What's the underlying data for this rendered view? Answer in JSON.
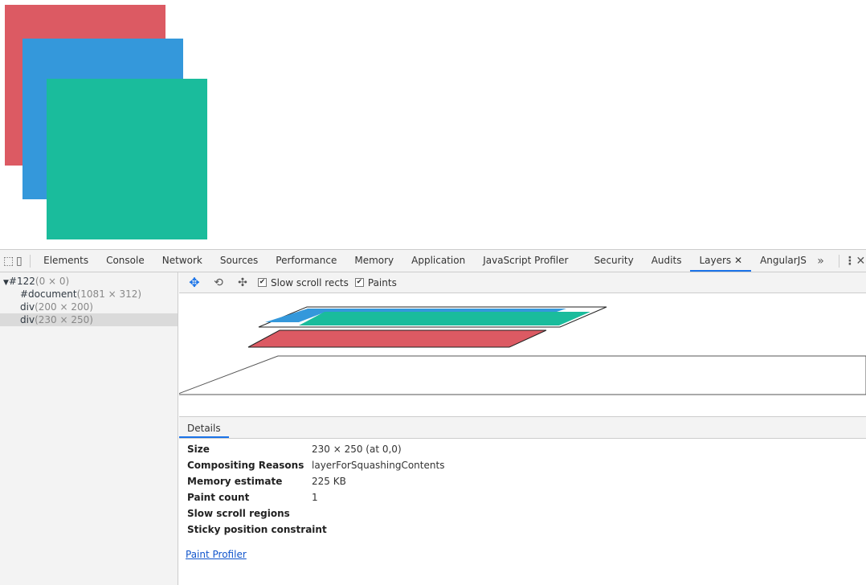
{
  "page": {
    "colors": {
      "red": "#dc5a63",
      "blue": "#3498db",
      "green": "#1abc9c"
    }
  },
  "tabs": [
    "Elements",
    "Console",
    "Network",
    "Sources",
    "Performance",
    "Memory",
    "Application",
    "JavaScript Profiler",
    "Security",
    "Audits",
    "Layers",
    "AngularJS"
  ],
  "active_tab": "Layers",
  "tree": [
    {
      "name": "#122",
      "dim": "(0 × 0)"
    },
    {
      "name": "#document",
      "dim": "(1081 × 312)"
    },
    {
      "name": "div",
      "dim": "(200 × 200)"
    },
    {
      "name": "div",
      "dim": "(230 × 250)"
    }
  ],
  "toolbar": {
    "slow_scroll": "Slow scroll rects",
    "paints": "Paints"
  },
  "details": {
    "tab": "Details",
    "rows": [
      {
        "k": "Size",
        "v": "230 × 250 (at 0,0)"
      },
      {
        "k": "Compositing Reasons",
        "v": "layerForSquashingContents"
      },
      {
        "k": "Memory estimate",
        "v": "225 KB"
      },
      {
        "k": "Paint count",
        "v": "1"
      },
      {
        "k": "Slow scroll regions",
        "v": ""
      },
      {
        "k": "Sticky position constraint",
        "v": ""
      }
    ],
    "link": "Paint Profiler"
  }
}
